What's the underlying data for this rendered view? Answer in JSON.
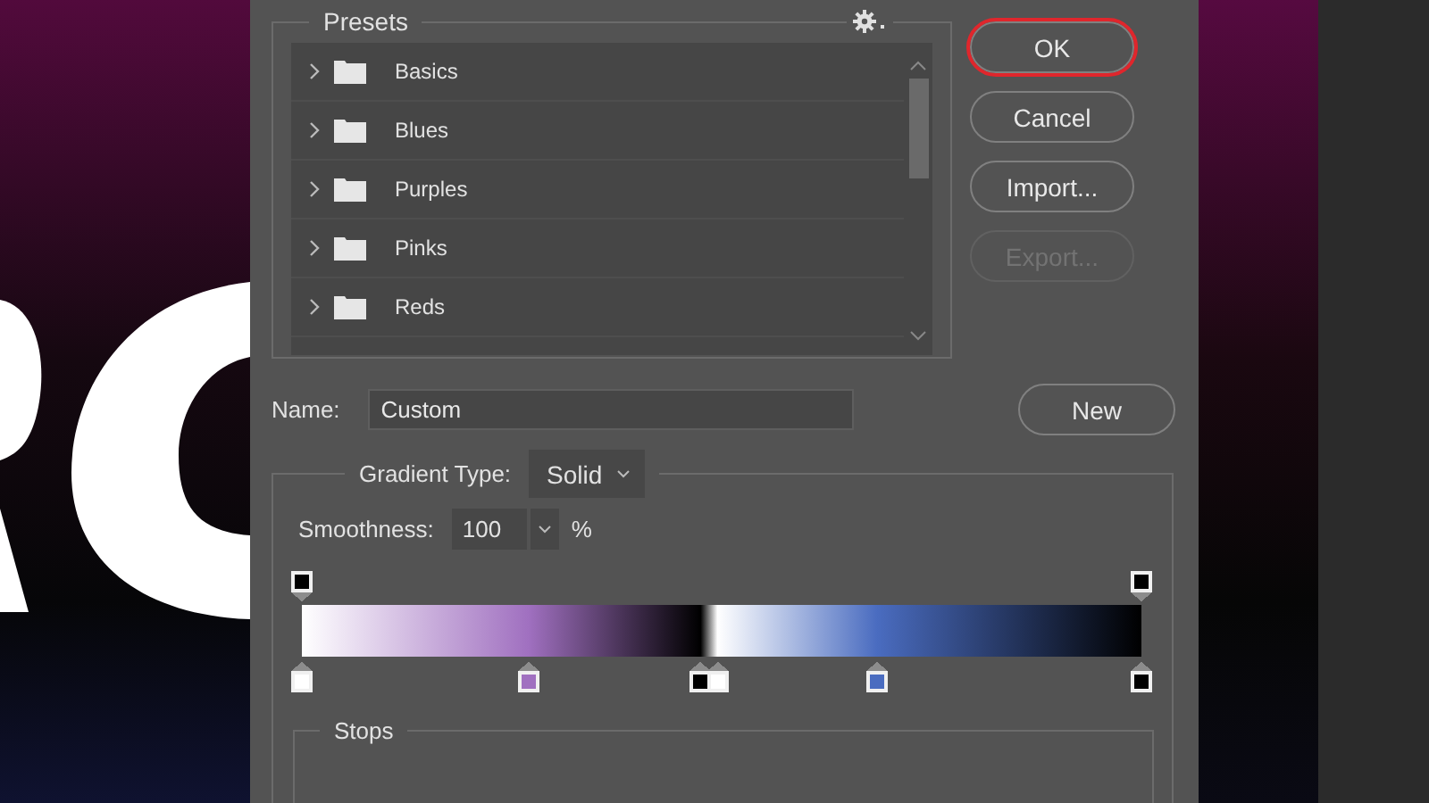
{
  "presets": {
    "title": "Presets",
    "items": [
      {
        "label": "Basics",
        "expanded": false
      },
      {
        "label": "Blues",
        "expanded": false
      },
      {
        "label": "Purples",
        "expanded": false
      },
      {
        "label": "Pinks",
        "expanded": false
      },
      {
        "label": "Reds",
        "expanded": false
      }
    ]
  },
  "buttons": [
    {
      "label": "OK",
      "focused": true,
      "disabled": false
    },
    {
      "label": "Cancel",
      "focused": false,
      "disabled": false
    },
    {
      "label": "Import...",
      "focused": false,
      "disabled": false
    },
    {
      "label": "Export...",
      "focused": false,
      "disabled": true
    }
  ],
  "name": {
    "label": "Name:",
    "value": "Custom"
  },
  "new_button": "New",
  "gradient": {
    "type_label": "Gradient Type:",
    "type_value": "Solid",
    "smoothness_label": "Smoothness:",
    "smoothness_value": "100",
    "smoothness_unit": "%",
    "opacity_stops": [
      {
        "level": 0,
        "color": "#000000"
      },
      {
        "level": 1,
        "color": "#000000"
      }
    ],
    "color_stops": [
      {
        "level": 0,
        "color": "#ffffff"
      },
      {
        "level": 0.27,
        "color": "#a070c0"
      },
      {
        "level": 0.475,
        "color": "#000000"
      },
      {
        "level": 0.495,
        "color": "#ffffff"
      },
      {
        "level": 0.685,
        "color": "#4a6cc0"
      },
      {
        "level": 1,
        "color": "#000000"
      }
    ]
  },
  "stops": {
    "title": "Stops"
  }
}
